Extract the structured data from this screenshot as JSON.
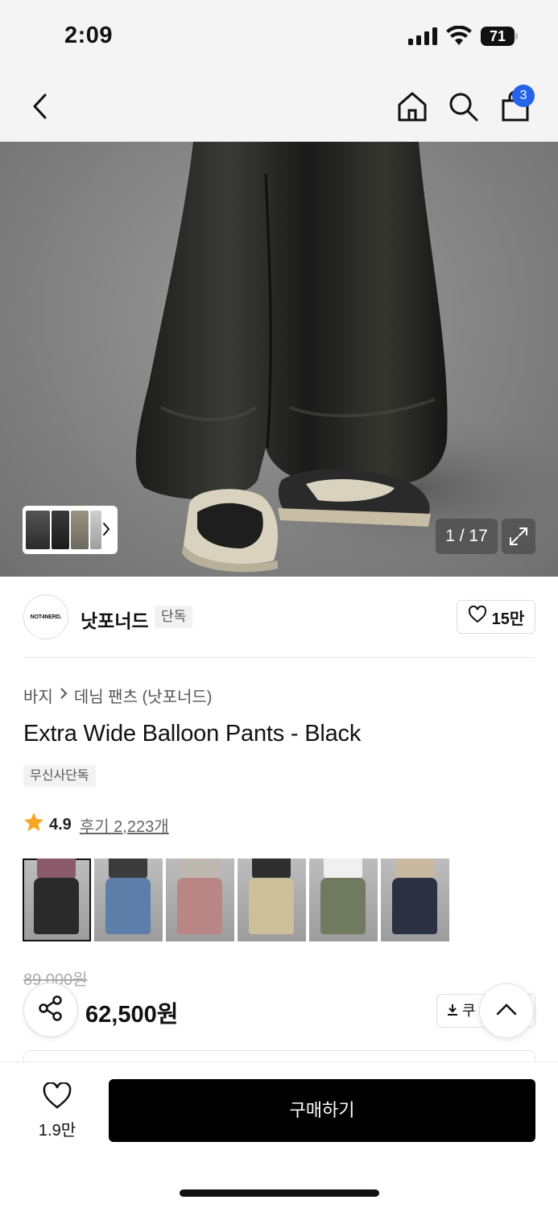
{
  "status_bar": {
    "time": "2:09",
    "battery": "71"
  },
  "nav": {
    "cart_count": "3",
    "icons": [
      "back-icon",
      "home-icon",
      "search-icon",
      "shopping-bag-icon"
    ]
  },
  "gallery": {
    "counter": "1 / 17",
    "icons": [
      "expand-icon",
      "chevron-right-icon"
    ]
  },
  "brand": {
    "logo_text": "NOT4NERD.",
    "name": "낫포너드",
    "tag": "단독",
    "likes": "15만"
  },
  "product": {
    "breadcrumb": [
      "바지",
      "데님 팬츠 (낫포너드)"
    ],
    "title": "Extra Wide Balloon Pants - Black",
    "store_tag": "무신사단독",
    "rating": "4.9",
    "reviews": "후기 2,223개",
    "swatches": [
      {
        "name": "black",
        "top": "#8a5a6a",
        "legs": "#2a2a2a"
      },
      {
        "name": "blue",
        "top": "#3b3b3b",
        "legs": "#5d7ea8"
      },
      {
        "name": "pink",
        "top": "#bfb8b0",
        "legs": "#b98585"
      },
      {
        "name": "beige",
        "top": "#2e2e2e",
        "legs": "#cdbf9a"
      },
      {
        "name": "khaki",
        "top": "#f0f0f0",
        "legs": "#6f7a5f"
      },
      {
        "name": "navy",
        "top": "#c9b9a1",
        "legs": "#2b3140"
      }
    ]
  },
  "price": {
    "original": "89,000원",
    "sale": "62,500원",
    "coupon": "쿠"
  },
  "footer": {
    "wish_count": "1.9만",
    "buy_label": "구매하기"
  },
  "colors": {
    "accent": "#2563eb",
    "buy": "#000000",
    "star": "#f5a623"
  }
}
